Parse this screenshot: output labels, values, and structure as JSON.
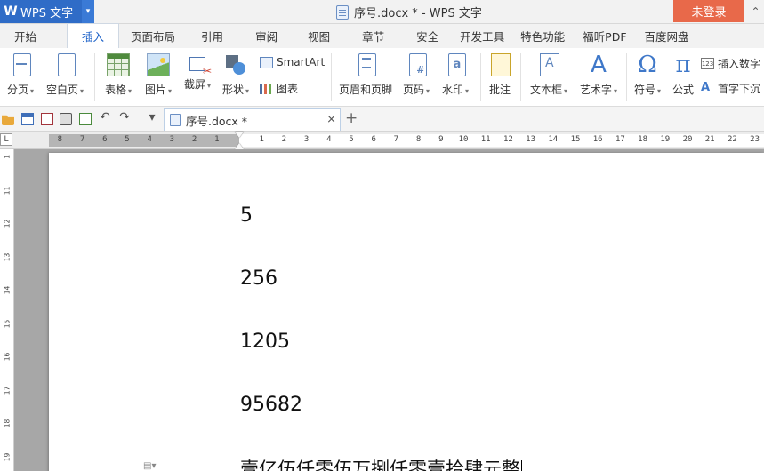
{
  "titlebar": {
    "app_name": "WPS 文字",
    "app_logo": "W",
    "document_title": "序号.docx * - WPS 文字",
    "login_label": "未登录",
    "window_control_icon": "chevron-up-icon"
  },
  "menu_tabs": [
    {
      "label": "开始",
      "active": false
    },
    {
      "label": "插入",
      "active": true
    },
    {
      "label": "页面布局",
      "active": false
    },
    {
      "label": "引用",
      "active": false
    },
    {
      "label": "审阅",
      "active": false
    },
    {
      "label": "视图",
      "active": false
    },
    {
      "label": "章节",
      "active": false
    },
    {
      "label": "安全",
      "active": false
    },
    {
      "label": "开发工具",
      "active": false
    },
    {
      "label": "特色功能",
      "active": false
    },
    {
      "label": "福昕PDF",
      "active": false
    },
    {
      "label": "百度网盘",
      "active": false
    }
  ],
  "ribbon": {
    "page_break": "分页",
    "blank_page": "空白页",
    "table": "表格",
    "picture": "图片",
    "screenshot": "截屏",
    "shapes": "形状",
    "smartart": "SmartArt",
    "chart": "图表",
    "header_footer": "页眉和页脚",
    "page_number": "页码",
    "watermark": "水印",
    "comment": "批注",
    "text_box": "文本框",
    "word_art": "艺术字",
    "symbol": "符号",
    "formula": "公式",
    "insert_number": "插入数字",
    "drop_cap": "首字下沉",
    "symbol_glyph": "Ω",
    "formula_glyph": "π",
    "wordart_glyph": "A",
    "insert_number_badge": "123"
  },
  "quickbar": {
    "doc_tab_label": "序号.docx *",
    "close_glyph": "×",
    "new_tab_glyph": "+",
    "undo_glyph": "↶",
    "redo_glyph": "↷",
    "more_glyph": "▾"
  },
  "ruler": {
    "corner": "L",
    "left_ticks": [
      "8",
      "7",
      "6",
      "5",
      "4",
      "3",
      "2",
      "1"
    ],
    "right_ticks": [
      "1",
      "2",
      "3",
      "4",
      "5",
      "6",
      "7",
      "8",
      "9",
      "10",
      "11",
      "12",
      "13",
      "14",
      "15",
      "16",
      "17",
      "18",
      "19",
      "20",
      "21",
      "22",
      "23"
    ],
    "vertical_ticks": [
      "1",
      "11",
      "12",
      "13",
      "14",
      "15",
      "16",
      "17",
      "18",
      "19"
    ]
  },
  "document": {
    "paragraphs": [
      "5",
      "256",
      "1205",
      "95682",
      "壹亿伍仟零伍万捌仟零壹拾肆元整"
    ]
  },
  "colors": {
    "accent": "#1d62c8",
    "app_menu_bg": "#2f6cc7",
    "login_bg": "#e8694a",
    "canvas_bg": "#a7a7a7"
  }
}
